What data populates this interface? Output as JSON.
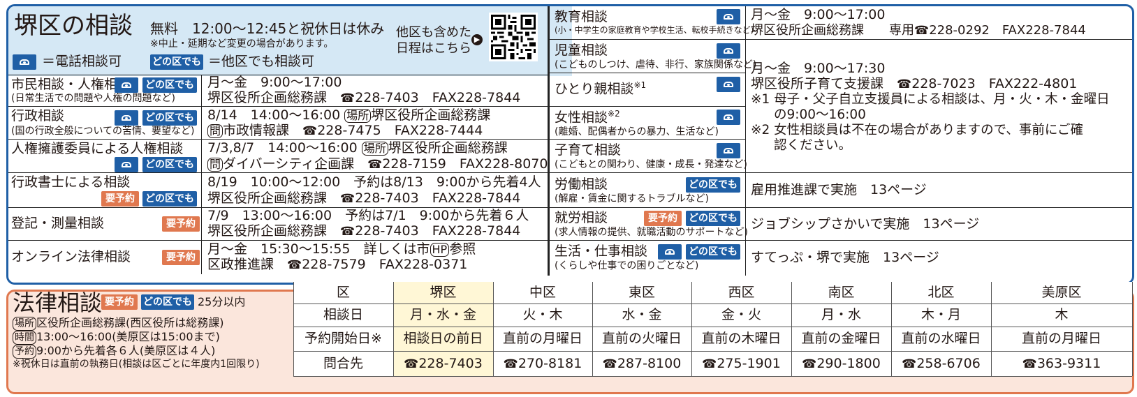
{
  "header": {
    "title": "堺区の相談",
    "hours": "無料　12:00～12:45と祝休日は休み",
    "note": "※中止・延期など変更の場合があります。",
    "other_ward_line1": "他区も含めた",
    "other_ward_line2": "日程はこちら",
    "legend_phone": "＝電話相談可",
    "legend_any": "＝他区でも相談可",
    "any_badge": "どの区でも"
  },
  "badges": {
    "any": "どの区でも",
    "reserve": "要予約"
  },
  "left_rows": [
    {
      "name": "市民相談・人権相談",
      "sub": "(日常生活での問題や人権の問題など)",
      "l1": "月～金　9:00～17:00",
      "l2a": "堺区役所企画総務課　",
      "tel": "228-7403",
      "fax": "FAX228-7844"
    },
    {
      "name": "行政相談",
      "sub": "(国の行政全般についての苦情、要望など)",
      "l1a": "8/14　14:00～16:00 ",
      "place": "場所",
      "l1b": "堺区役所企画総務課",
      "ask": "問",
      "l2a": "市政情報課　",
      "tel": "228-7475",
      "fax": "FAX228-7444"
    },
    {
      "name": "人権擁護委員による人権相談",
      "l1a": "7/3,8/7　14:00～16:00 ",
      "place": "場所",
      "l1b": "堺区役所企画総務課",
      "ask": "問",
      "l2a": "ダイバーシティ企画課　",
      "tel": "228-7159",
      "fax": "FAX228-8070"
    },
    {
      "name": "行政書士による相談",
      "l1": "8/19　10:00～12:00　予約は8/13　9:00から先着4人",
      "l2a": "堺区役所企画総務課　",
      "tel": "228-7403",
      "fax": "FAX228-7844"
    },
    {
      "name": "登記・測量相談",
      "l1": "7/9　13:00～16:00　予約は7/1　9:00から先着６人",
      "l2a": "堺区役所企画総務課　",
      "tel": "228-7403",
      "fax": "FAX228-7844"
    },
    {
      "name": "オンライン法律相談",
      "l1a": "月～金　15:30～15:55　詳しくは市",
      "hp": "HP",
      "l1b": "参照",
      "l2a": "区政推進課　",
      "tel": "228-7579",
      "fax": "FAX228-0371"
    }
  ],
  "right_rows": [
    {
      "name": "教育相談",
      "sub": "(小・中学生の家庭教育や学校生活、転校手続きなど)"
    },
    {
      "name": "児童相談",
      "sub": "(こどものしつけ、虐待、非行、家族関係など)"
    },
    {
      "name": "ひとり親相談",
      "sup": "※1"
    },
    {
      "name": "女性相談",
      "sup": "※2",
      "sub": "(離婚、配偶者からの暴力、生活など)"
    },
    {
      "name": "子育て相談",
      "sub": "(こどもとの関わり、健康・成長・発達など)"
    },
    {
      "name": "労働相談",
      "sub": "(解雇・賃金に関するトラブルなど)"
    },
    {
      "name": "就労相談",
      "sub": "(求人情報の提供、就職活動のサポートなど)"
    },
    {
      "name": "生活・仕事相談",
      "sub": "(くらしや仕事での困りごとなど)"
    }
  ],
  "right_info": {
    "edu_l1": "月～金　9:00～17:00",
    "edu_l2": "堺区役所企画総務課　　専用",
    "edu_tel": "228-0292",
    "edu_fax": "FAX228-7844",
    "child_l1": "月～金　9:00～17:30",
    "child_l2": "堺区役所子育て支援課　",
    "child_tel": "228-7023",
    "child_fax": "FAX222-4801",
    "n1a": "※1 母子・父子自立支援員による相談は、月・火・木・金曜日",
    "n1b": "の9:00～16:00",
    "n2a": "※2 女性相談員は不在の場合がありますので、事前にご確",
    "n2b": "認ください。",
    "labor": "雇用推進課で実施　13ページ",
    "job": "ジョブシップさかいで実施　13ページ",
    "life": "すてっぷ・堺で実施　13ページ"
  },
  "law": {
    "title": "法律相談",
    "duration": "25分以内",
    "place": "場所",
    "place_text": "区役所企画総務課(西区役所は総務課)",
    "time": "時間",
    "time_text": "13:00～16:00(美原区は15:00まで)",
    "reserve": "予約",
    "reserve_text": "9:00から先着各６人(美原区は４人)",
    "note": "※祝休日は直前の執務日(相談は区ごとに年度内1回限り)"
  },
  "law_table": {
    "headers": [
      "区",
      "堺区",
      "中区",
      "東区",
      "西区",
      "南区",
      "北区",
      "美原区"
    ],
    "rows": [
      [
        "相談日",
        "月・水・金",
        "火・木",
        "水・金",
        "金・火",
        "月・水",
        "木・月",
        "木"
      ],
      [
        "予約開始日※",
        "相談日の前日",
        "直前の月曜日",
        "直前の火曜日",
        "直前の木曜日",
        "直前の金曜日",
        "直前の水曜日",
        "直前の月曜日"
      ],
      [
        "問合先",
        "228-7403",
        "270-8181",
        "287-8100",
        "275-1901",
        "290-1800",
        "258-6706",
        "363-9311"
      ]
    ]
  },
  "colors": {
    "blue": "#1f5fa6",
    "orange": "#e0784f",
    "header_bg": "#d5e8f5",
    "law_bg": "#fbe6dc",
    "highlight": "#fff7d6"
  }
}
